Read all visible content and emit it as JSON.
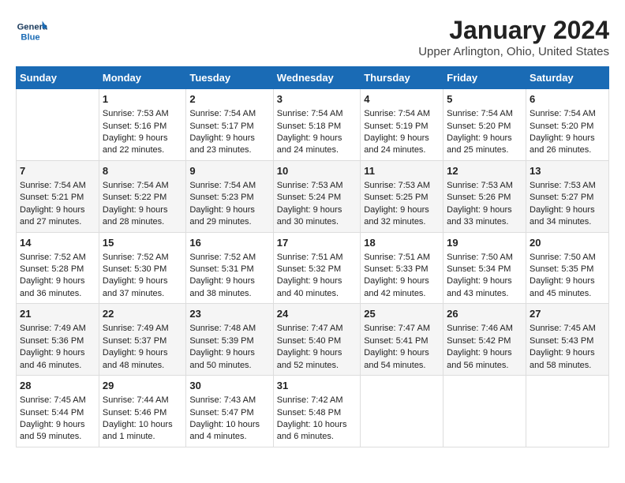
{
  "header": {
    "logo_line1": "General",
    "logo_line2": "Blue",
    "title": "January 2024",
    "subtitle": "Upper Arlington, Ohio, United States"
  },
  "days_of_week": [
    "Sunday",
    "Monday",
    "Tuesday",
    "Wednesday",
    "Thursday",
    "Friday",
    "Saturday"
  ],
  "weeks": [
    [
      {
        "day": "",
        "info": ""
      },
      {
        "day": "1",
        "info": "Sunrise: 7:53 AM\nSunset: 5:16 PM\nDaylight: 9 hours\nand 22 minutes."
      },
      {
        "day": "2",
        "info": "Sunrise: 7:54 AM\nSunset: 5:17 PM\nDaylight: 9 hours\nand 23 minutes."
      },
      {
        "day": "3",
        "info": "Sunrise: 7:54 AM\nSunset: 5:18 PM\nDaylight: 9 hours\nand 24 minutes."
      },
      {
        "day": "4",
        "info": "Sunrise: 7:54 AM\nSunset: 5:19 PM\nDaylight: 9 hours\nand 24 minutes."
      },
      {
        "day": "5",
        "info": "Sunrise: 7:54 AM\nSunset: 5:20 PM\nDaylight: 9 hours\nand 25 minutes."
      },
      {
        "day": "6",
        "info": "Sunrise: 7:54 AM\nSunset: 5:20 PM\nDaylight: 9 hours\nand 26 minutes."
      }
    ],
    [
      {
        "day": "7",
        "info": "Sunrise: 7:54 AM\nSunset: 5:21 PM\nDaylight: 9 hours\nand 27 minutes."
      },
      {
        "day": "8",
        "info": "Sunrise: 7:54 AM\nSunset: 5:22 PM\nDaylight: 9 hours\nand 28 minutes."
      },
      {
        "day": "9",
        "info": "Sunrise: 7:54 AM\nSunset: 5:23 PM\nDaylight: 9 hours\nand 29 minutes."
      },
      {
        "day": "10",
        "info": "Sunrise: 7:53 AM\nSunset: 5:24 PM\nDaylight: 9 hours\nand 30 minutes."
      },
      {
        "day": "11",
        "info": "Sunrise: 7:53 AM\nSunset: 5:25 PM\nDaylight: 9 hours\nand 32 minutes."
      },
      {
        "day": "12",
        "info": "Sunrise: 7:53 AM\nSunset: 5:26 PM\nDaylight: 9 hours\nand 33 minutes."
      },
      {
        "day": "13",
        "info": "Sunrise: 7:53 AM\nSunset: 5:27 PM\nDaylight: 9 hours\nand 34 minutes."
      }
    ],
    [
      {
        "day": "14",
        "info": "Sunrise: 7:52 AM\nSunset: 5:28 PM\nDaylight: 9 hours\nand 36 minutes."
      },
      {
        "day": "15",
        "info": "Sunrise: 7:52 AM\nSunset: 5:30 PM\nDaylight: 9 hours\nand 37 minutes."
      },
      {
        "day": "16",
        "info": "Sunrise: 7:52 AM\nSunset: 5:31 PM\nDaylight: 9 hours\nand 38 minutes."
      },
      {
        "day": "17",
        "info": "Sunrise: 7:51 AM\nSunset: 5:32 PM\nDaylight: 9 hours\nand 40 minutes."
      },
      {
        "day": "18",
        "info": "Sunrise: 7:51 AM\nSunset: 5:33 PM\nDaylight: 9 hours\nand 42 minutes."
      },
      {
        "day": "19",
        "info": "Sunrise: 7:50 AM\nSunset: 5:34 PM\nDaylight: 9 hours\nand 43 minutes."
      },
      {
        "day": "20",
        "info": "Sunrise: 7:50 AM\nSunset: 5:35 PM\nDaylight: 9 hours\nand 45 minutes."
      }
    ],
    [
      {
        "day": "21",
        "info": "Sunrise: 7:49 AM\nSunset: 5:36 PM\nDaylight: 9 hours\nand 46 minutes."
      },
      {
        "day": "22",
        "info": "Sunrise: 7:49 AM\nSunset: 5:37 PM\nDaylight: 9 hours\nand 48 minutes."
      },
      {
        "day": "23",
        "info": "Sunrise: 7:48 AM\nSunset: 5:39 PM\nDaylight: 9 hours\nand 50 minutes."
      },
      {
        "day": "24",
        "info": "Sunrise: 7:47 AM\nSunset: 5:40 PM\nDaylight: 9 hours\nand 52 minutes."
      },
      {
        "day": "25",
        "info": "Sunrise: 7:47 AM\nSunset: 5:41 PM\nDaylight: 9 hours\nand 54 minutes."
      },
      {
        "day": "26",
        "info": "Sunrise: 7:46 AM\nSunset: 5:42 PM\nDaylight: 9 hours\nand 56 minutes."
      },
      {
        "day": "27",
        "info": "Sunrise: 7:45 AM\nSunset: 5:43 PM\nDaylight: 9 hours\nand 58 minutes."
      }
    ],
    [
      {
        "day": "28",
        "info": "Sunrise: 7:45 AM\nSunset: 5:44 PM\nDaylight: 9 hours\nand 59 minutes."
      },
      {
        "day": "29",
        "info": "Sunrise: 7:44 AM\nSunset: 5:46 PM\nDaylight: 10 hours\nand 1 minute."
      },
      {
        "day": "30",
        "info": "Sunrise: 7:43 AM\nSunset: 5:47 PM\nDaylight: 10 hours\nand 4 minutes."
      },
      {
        "day": "31",
        "info": "Sunrise: 7:42 AM\nSunset: 5:48 PM\nDaylight: 10 hours\nand 6 minutes."
      },
      {
        "day": "",
        "info": ""
      },
      {
        "day": "",
        "info": ""
      },
      {
        "day": "",
        "info": ""
      }
    ]
  ]
}
